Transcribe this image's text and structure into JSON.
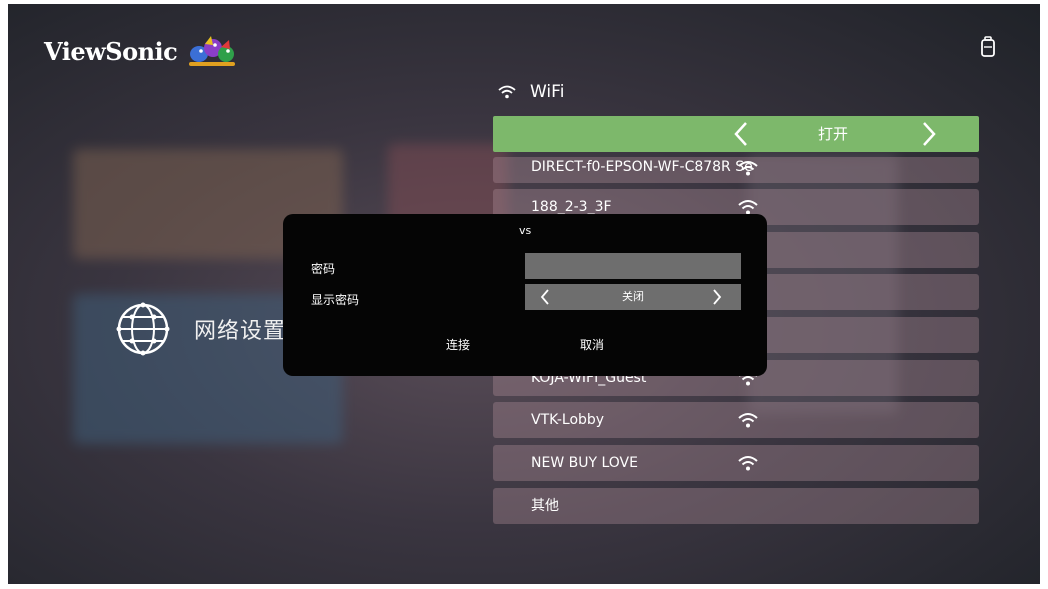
{
  "brand": {
    "name": "ViewSonic"
  },
  "category": {
    "label": "网络设置"
  },
  "wifi": {
    "title": "WiFi",
    "toggle_value": "打开",
    "networks": [
      {
        "name": "DIRECT-f0-EPSON-WF-C878R Se"
      },
      {
        "name": "188_2-3_3F"
      },
      {
        "name": ""
      },
      {
        "name": ""
      },
      {
        "name": ""
      },
      {
        "name": "KOJA-WIFI_Guest"
      },
      {
        "name": "VTK-Lobby"
      },
      {
        "name": "NEW BUY LOVE"
      }
    ],
    "other_label": "其他"
  },
  "dialog": {
    "ssid": "vs",
    "password_label": "密码",
    "password_value": "",
    "show_password_label": "显示密码",
    "show_password_value": "关闭",
    "connect_label": "连接",
    "cancel_label": "取消"
  },
  "colors": {
    "toggle_active": "#7db86b",
    "dialog_bg": "#050505",
    "field_bg": "#6e6e6e"
  },
  "icons": {
    "wifi": "wifi-icon",
    "globe": "globe-icon",
    "battery": "battery-icon",
    "chevron_left": "chevron-left-icon",
    "chevron_right": "chevron-right-icon"
  }
}
